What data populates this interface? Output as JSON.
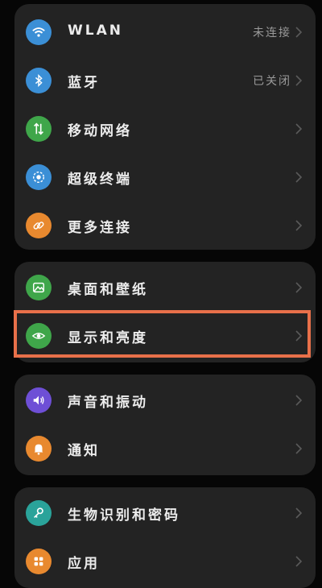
{
  "groups": [
    {
      "items": [
        {
          "label": "WLAN",
          "value": "未连接",
          "icon": "wifi-icon",
          "color": "#3b8fd6"
        },
        {
          "label": "蓝牙",
          "value": "已关闭",
          "icon": "bluetooth-icon",
          "color": "#3b8fd6"
        },
        {
          "label": "移动网络",
          "value": "",
          "icon": "mobile-data-icon",
          "color": "#3fa64a"
        },
        {
          "label": "超级终端",
          "value": "",
          "icon": "super-device-icon",
          "color": "#3b8fd6"
        },
        {
          "label": "更多连接",
          "value": "",
          "icon": "link-icon",
          "color": "#e8892f"
        }
      ]
    },
    {
      "items": [
        {
          "label": "桌面和壁纸",
          "value": "",
          "icon": "wallpaper-icon",
          "color": "#3fa64a"
        },
        {
          "label": "显示和亮度",
          "value": "",
          "icon": "eye-icon",
          "color": "#3fa64a"
        }
      ]
    },
    {
      "items": [
        {
          "label": "声音和振动",
          "value": "",
          "icon": "sound-icon",
          "color": "#6e4fd6"
        },
        {
          "label": "通知",
          "value": "",
          "icon": "bell-icon",
          "color": "#e8892f"
        }
      ]
    },
    {
      "items": [
        {
          "label": "生物识别和密码",
          "value": "",
          "icon": "key-icon",
          "color": "#2aa39a"
        },
        {
          "label": "应用",
          "value": "",
          "icon": "apps-icon",
          "color": "#e8892f"
        }
      ]
    }
  ],
  "highlight_color": "#e8704a"
}
